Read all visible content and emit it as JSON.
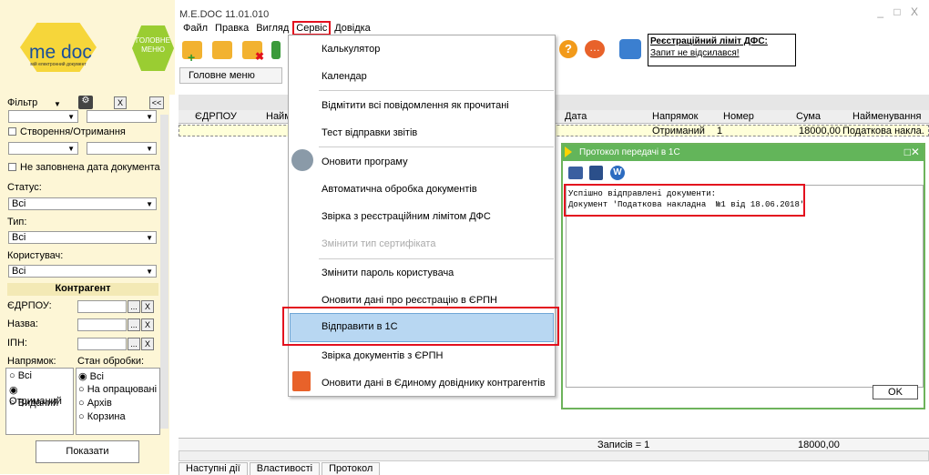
{
  "window": {
    "title": "M.E.DOC 11.01.010",
    "controls": "_ □ X"
  },
  "logo": {
    "brand": "me doc",
    "tagline": "мій електронний документ",
    "main_menu_hex": "ГОЛОВНЕ МЕНЮ"
  },
  "menubar": [
    "Файл",
    "Правка",
    "Вигляд",
    "Сервіс",
    "Довідка"
  ],
  "dfs": {
    "title": "Реєстраційний ліміт ДФС:",
    "link": "Запит не відсилався!"
  },
  "tab_main": "Головне меню",
  "sidebar": {
    "filter_label": "Фільтр",
    "x_btn": "X",
    "collapse_btn": "<<",
    "created_received": "Створення/Отримання",
    "not_filled_date": "Не заповнена дата документа",
    "status_label": "Статус:",
    "status_value": "Всі",
    "type_label": "Тип:",
    "type_value": "Всі",
    "user_label": "Користувач:",
    "user_value": "Всі",
    "counterparty": "Контрагент",
    "edrpou_label": "ЄДРПОУ:",
    "name_label": "Назва:",
    "ipn_label": "ІПН:",
    "dots": "...",
    "x": "X",
    "direction_label": "Напрямок:",
    "processing_label": "Стан обробки:",
    "direction_options": [
      "Всі",
      "Отриманий",
      "Виданий"
    ],
    "processing_options": [
      "Всі",
      "На опрацювані",
      "Архів",
      "Корзина"
    ],
    "show_button": "Показати"
  },
  "grid": {
    "columns": [
      "ЄДРПОУ",
      "Найм",
      "Дата",
      "Напрямок",
      "Номер",
      "Сума",
      "Найменування"
    ],
    "row": {
      "direction": "Отриманий",
      "number": "1",
      "sum": "18000,00",
      "name": "Податкова накла."
    },
    "footer_records": "Записів = 1",
    "footer_sum": "18000,00"
  },
  "service_menu": [
    {
      "label": "Калькулятор",
      "disabled": false
    },
    {
      "label": "Календар",
      "disabled": false
    },
    {
      "label": "Відмітити всі повідомлення як прочитані",
      "disabled": false
    },
    {
      "label": "Тест відправки звітів",
      "disabled": false
    },
    {
      "label": "Оновити програму",
      "disabled": false
    },
    {
      "label": "Автоматична обробка документів",
      "disabled": false
    },
    {
      "label": "Звірка з реєстраційним лімітом ДФС",
      "disabled": false
    },
    {
      "label": "Змінити тип сертифіката",
      "disabled": true
    },
    {
      "label": "Змінити пароль користувача",
      "disabled": false
    },
    {
      "label": "Оновити дані про реєстрацію в ЄРПН",
      "disabled": false
    },
    {
      "label": "Відправити в 1С",
      "disabled": false,
      "highlighted": true
    },
    {
      "label": "Звірка документів з ЄРПН",
      "disabled": false
    },
    {
      "label": "Оновити дані в Єдиному довіднику контрагентів",
      "disabled": false
    }
  ],
  "protocol": {
    "title": "Протокол передачі в 1С",
    "line1": "Успішно відправлені документи:",
    "line2": "Документ 'Податкова накладна  №1 від 18.06.2018'",
    "ok": "OK"
  },
  "bottom_tabs": [
    "Наступні дії",
    "Властивості",
    "Протокол"
  ],
  "colors": {
    "accent_red": "#e3101e",
    "highlight": "#b8d7f2",
    "protocol_green": "#63b55a",
    "sidebar_bg": "#fdf6d6"
  }
}
